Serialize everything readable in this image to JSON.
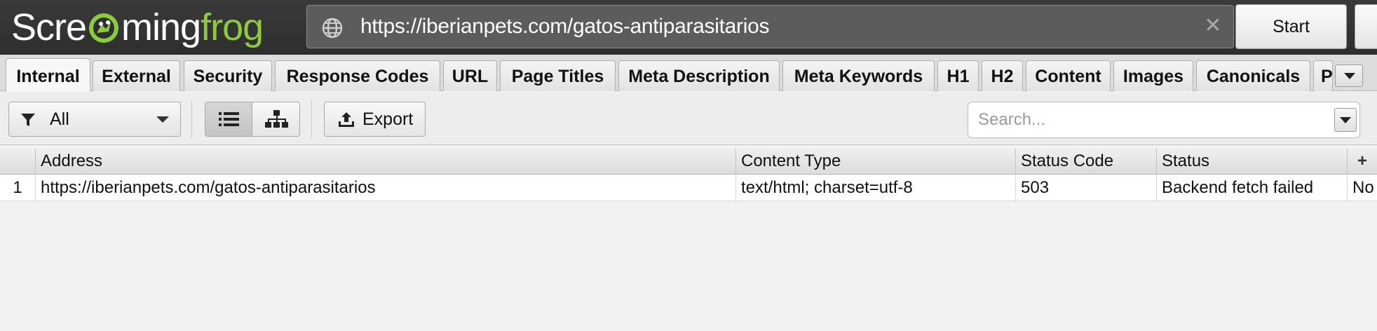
{
  "app": {
    "logo_part1": "Scre",
    "logo_part2": "ming",
    "logo_part3": "frog",
    "brand_green": "#8ccc3a"
  },
  "topbar": {
    "url": "https://iberianpets.com/gatos-antiparasitarios",
    "start_label": "Start",
    "url_icon": "globe-icon",
    "clear_icon": "close-icon",
    "clear_glyph": "✕"
  },
  "tabs": [
    {
      "label": "Internal",
      "active": true
    },
    {
      "label": "External"
    },
    {
      "label": "Security"
    },
    {
      "label": "Response Codes"
    },
    {
      "label": "URL"
    },
    {
      "label": "Page Titles"
    },
    {
      "label": "Meta Description"
    },
    {
      "label": "Meta Keywords"
    },
    {
      "label": "H1"
    },
    {
      "label": "H2"
    },
    {
      "label": "Content"
    },
    {
      "label": "Images"
    },
    {
      "label": "Canonicals"
    },
    {
      "label": "P"
    }
  ],
  "toolbar": {
    "filter_label": "All",
    "export_label": "Export",
    "search_placeholder": "Search..."
  },
  "table": {
    "columns": [
      "Address",
      "Content Type",
      "Status Code",
      "Status"
    ],
    "add_column_glyph": "+",
    "rows": [
      {
        "index": "1",
        "address": "https://iberianpets.com/gatos-antiparasitarios",
        "content_type": "text/html; charset=utf-8",
        "status_code": "503",
        "status": "Backend fetch failed",
        "overflow": "No"
      }
    ]
  }
}
